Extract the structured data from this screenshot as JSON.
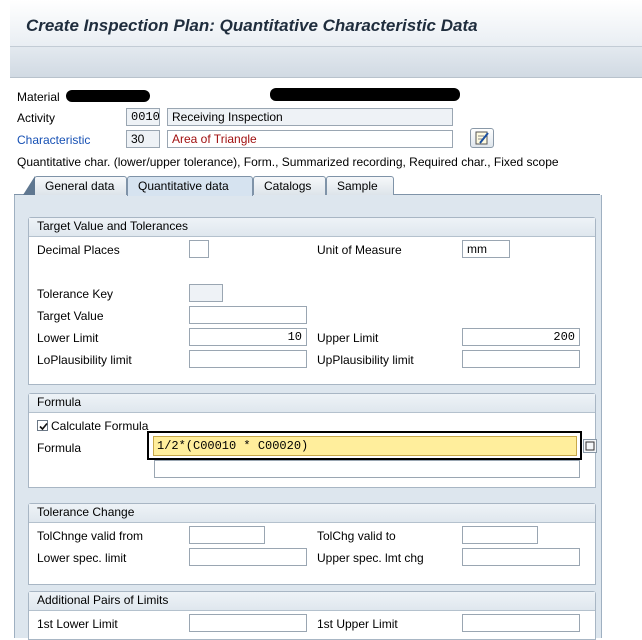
{
  "window": {
    "title": "Create Inspection Plan: Quantitative Characteristic Data"
  },
  "header": {
    "material_label": "Material",
    "activity_label": "Activity",
    "activity_number": "0010",
    "activity_text": "Receiving Inspection",
    "characteristic_label": "Characteristic",
    "characteristic_number": "30",
    "characteristic_text": "Area of Triangle",
    "control_summary": "Quantitative char. (lower/upper tolerance), Form., Summarized recording, Required char., Fixed scope"
  },
  "tabs": [
    {
      "label": "General data",
      "active": false
    },
    {
      "label": "Quantitative data",
      "active": true
    },
    {
      "label": "Catalogs",
      "active": false
    },
    {
      "label": "Sample",
      "active": false
    }
  ],
  "target_group": {
    "title": "Target Value and Tolerances",
    "decimal_places_label": "Decimal Places",
    "decimal_places_value": "",
    "uom_label": "Unit of Measure",
    "uom_value": "mm",
    "tolerance_key_label": "Tolerance Key",
    "tolerance_key_value": "",
    "target_value_label": "Target Value",
    "target_value_value": "",
    "lower_limit_label": "Lower Limit",
    "lower_limit_value": "10",
    "upper_limit_label": "Upper Limit",
    "upper_limit_value": "200",
    "lo_plaus_label": "LoPlausibility limit",
    "lo_plaus_value": "",
    "up_plaus_label": "UpPlausibility limit",
    "up_plaus_value": ""
  },
  "formula_group": {
    "title": "Formula",
    "calculate_label": "Calculate Formula",
    "calculate_checked": true,
    "formula_label": "Formula",
    "formula_line1": "1/2*(C00010 * C00020)",
    "formula_line2": ""
  },
  "tolerance_change_group": {
    "title": "Tolerance Change",
    "valid_from_label": "TolChnge valid from",
    "valid_from_value": "",
    "valid_to_label": "TolChg valid to",
    "valid_to_value": "",
    "lower_spec_label": "Lower spec. limit",
    "lower_spec_value": "",
    "upper_spec_label": "Upper spec. lmt chg",
    "upper_spec_value": ""
  },
  "additional_pairs_group": {
    "title": "Additional Pairs of Limits",
    "first_lower_label": "1st Lower Limit",
    "first_lower_value": "",
    "first_upper_label": "1st Upper Limit",
    "first_upper_value": ""
  },
  "colors": {
    "link_blue": "#1650b4",
    "required_red": "#a01010",
    "formula_highlight": "#ffee9c"
  }
}
